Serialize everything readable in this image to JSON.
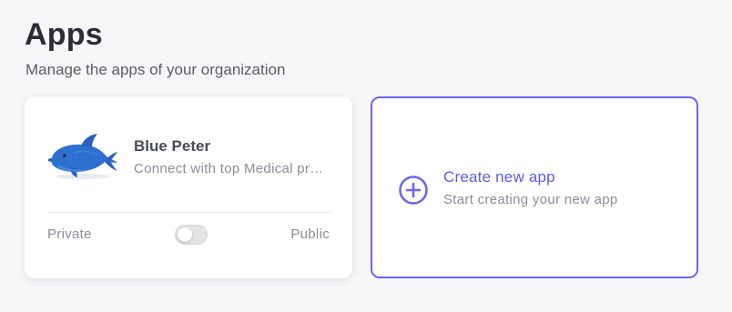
{
  "header": {
    "title": "Apps",
    "subtitle": "Manage the apps of your organization"
  },
  "apps": [
    {
      "name": "Blue Peter",
      "description": "Connect with top Medical professionals",
      "logo_icon": "blue-dolphin-icon",
      "visibility_left_label": "Private",
      "visibility_right_label": "Public",
      "is_public": false
    }
  ],
  "create": {
    "title": "Create new app",
    "description": "Start creating your new app",
    "icon": "plus-circle-icon"
  },
  "colors": {
    "background": "#f7f7fa",
    "accent": "#6b68e8",
    "accent_text": "#5e5be3",
    "title_text": "#2b2d3a",
    "muted_text": "#8b8d96"
  }
}
